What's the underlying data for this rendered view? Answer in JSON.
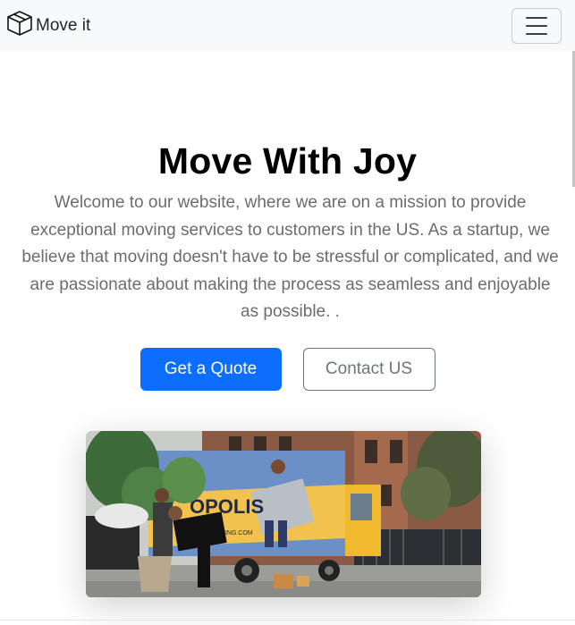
{
  "navbar": {
    "brand_text": "Move it",
    "brand_icon": "box-icon",
    "toggler_icon": "hamburger-menu-icon"
  },
  "hero": {
    "title": "Move With Joy",
    "lead": "Welcome to our website, where we are on a mission to provide exceptional moving services to customers in the US. As a startup, we believe that moving doesn't have to be stressful or complicated, and we are passionate about making the process as seamless and enjoyable as possible. .",
    "primary_button": "Get a Quote",
    "secondary_button": "Contact US"
  },
  "photo": {
    "truck_text": "OPOLIS",
    "truck_url": "MOVING.COM"
  },
  "colors": {
    "primary": "#0d6efd",
    "secondary": "#6c757d",
    "navbar_bg": "#f8f9fa"
  }
}
